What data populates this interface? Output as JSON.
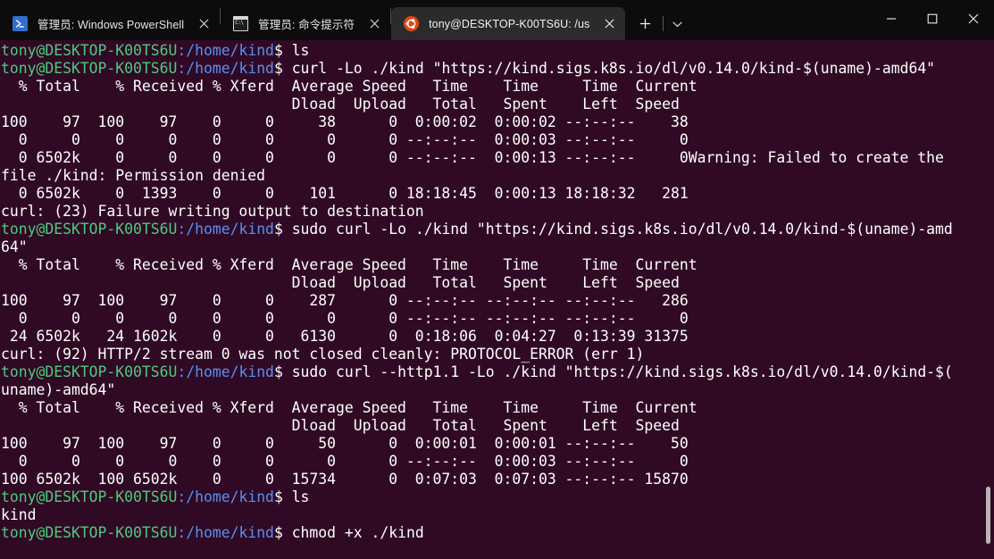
{
  "window": {
    "tabs": [
      {
        "id": "tab-powershell",
        "icon": "powershell-icon",
        "title": "管理员: Windows PowerShell",
        "active": false,
        "close_label": "✕"
      },
      {
        "id": "tab-cmd",
        "icon": "cmd-icon",
        "title": "管理员: 命令提示符",
        "active": false,
        "close_label": "✕"
      },
      {
        "id": "tab-ubuntu",
        "icon": "ubuntu-icon",
        "title": "tony@DESKTOP-K00TS6U: /us",
        "active": true,
        "close_label": "✕"
      }
    ],
    "new_tab_label": "+",
    "dropdown_label": "⌄",
    "controls": {
      "minimize": "—",
      "maximize": "☐",
      "close": "✕"
    },
    "cmd_icon_text": "C:\\"
  },
  "terminal": {
    "background": "#300a24",
    "prompt_user_color": "#4ec97e",
    "prompt_path_color": "#5a8ff0",
    "text_color": "#ffffff",
    "prompt_user": "tony@DESKTOP-K00TS6U",
    "prompt_sep": ":",
    "prompt_path": "/home/kind",
    "prompt_dollar": "$ ",
    "lines": [
      {
        "type": "prompt",
        "command": "ls"
      },
      {
        "type": "prompt",
        "command": "curl -Lo ./kind \"https://kind.sigs.k8s.io/dl/v0.14.0/kind-$(uname)-amd64\""
      },
      {
        "type": "out",
        "text": "  % Total    % Received % Xferd  Average Speed   Time    Time     Time  Current"
      },
      {
        "type": "out",
        "text": "                                 Dload  Upload   Total   Spent    Left  Speed"
      },
      {
        "type": "out",
        "text": "100    97  100    97    0     0     38      0  0:00:02  0:00:02 --:--:--    38"
      },
      {
        "type": "out",
        "text": "  0     0    0     0    0     0      0      0 --:--:--  0:00:03 --:--:--     0"
      },
      {
        "type": "out",
        "text": "  0 6502k    0     0    0     0      0      0 --:--:--  0:00:13 --:--:--     0Warning: Failed to create the"
      },
      {
        "type": "out",
        "text": "file ./kind: Permission denied"
      },
      {
        "type": "out",
        "text": "  0 6502k    0  1393    0     0    101      0 18:18:45  0:00:13 18:18:32   281"
      },
      {
        "type": "out",
        "text": "curl: (23) Failure writing output to destination"
      },
      {
        "type": "prompt",
        "command": "sudo curl -Lo ./kind \"https://kind.sigs.k8s.io/dl/v0.14.0/kind-$(uname)-amd"
      },
      {
        "type": "out",
        "text": "64\""
      },
      {
        "type": "out",
        "text": "  % Total    % Received % Xferd  Average Speed   Time    Time     Time  Current"
      },
      {
        "type": "out",
        "text": "                                 Dload  Upload   Total   Spent    Left  Speed"
      },
      {
        "type": "out",
        "text": "100    97  100    97    0     0    287      0 --:--:-- --:--:-- --:--:--   286"
      },
      {
        "type": "out",
        "text": "  0     0    0     0    0     0      0      0 --:--:-- --:--:-- --:--:--     0"
      },
      {
        "type": "out",
        "text": " 24 6502k   24 1602k    0     0   6130      0  0:18:06  0:04:27  0:13:39 31375"
      },
      {
        "type": "out",
        "text": "curl: (92) HTTP/2 stream 0 was not closed cleanly: PROTOCOL_ERROR (err 1)"
      },
      {
        "type": "prompt",
        "command": "sudo curl --http1.1 -Lo ./kind \"https://kind.sigs.k8s.io/dl/v0.14.0/kind-$("
      },
      {
        "type": "out",
        "text": "uname)-amd64\""
      },
      {
        "type": "out",
        "text": "  % Total    % Received % Xferd  Average Speed   Time    Time     Time  Current"
      },
      {
        "type": "out",
        "text": "                                 Dload  Upload   Total   Spent    Left  Speed"
      },
      {
        "type": "out",
        "text": "100    97  100    97    0     0     50      0  0:00:01  0:00:01 --:--:--    50"
      },
      {
        "type": "out",
        "text": "  0     0    0     0    0     0      0      0 --:--:--  0:00:03 --:--:--     0"
      },
      {
        "type": "out",
        "text": "100 6502k  100 6502k    0     0  15734      0  0:07:03  0:07:03 --:--:-- 15870"
      },
      {
        "type": "prompt",
        "command": "ls"
      },
      {
        "type": "out",
        "text": "kind"
      },
      {
        "type": "prompt",
        "command": "chmod +x ./kind"
      }
    ],
    "scrollbar": {
      "thumb_top_pct": 86,
      "thumb_height_pct": 11
    }
  }
}
